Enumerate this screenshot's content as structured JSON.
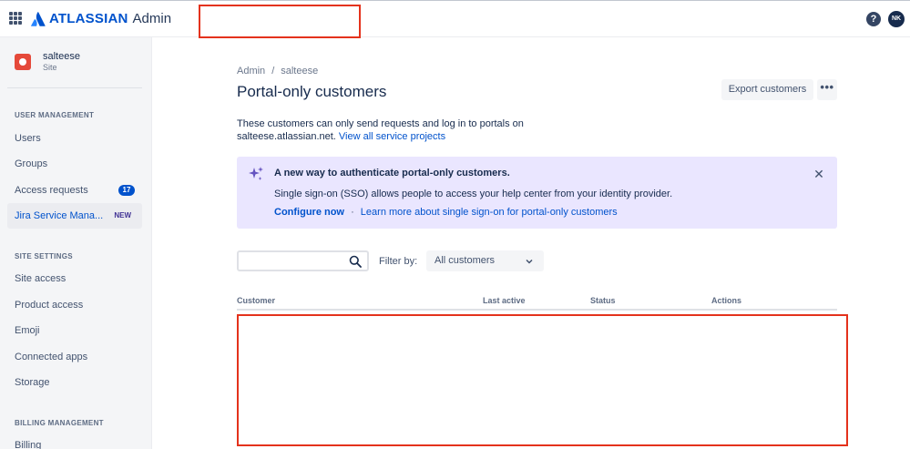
{
  "header": {
    "logo_word": "ATLASSIAN",
    "logo_product": "Admin",
    "help_icon": "question-circle-icon",
    "avatar_initials": "NK"
  },
  "sidebar": {
    "site_name": "salteese",
    "site_type": "Site",
    "sections": [
      {
        "heading": "USER MANAGEMENT"
      },
      {
        "heading": "SITE SETTINGS"
      },
      {
        "heading": "BILLING MANAGEMENT"
      }
    ],
    "items": {
      "users": "Users",
      "groups": "Groups",
      "access_requests": "Access requests",
      "access_requests_count": "17",
      "jira_service": "Jira Service Mana...",
      "jira_service_badge": "NEW",
      "site_access": "Site access",
      "product_access": "Product access",
      "emoji": "Emoji",
      "connected_apps": "Connected apps",
      "storage": "Storage",
      "billing": "Billing"
    }
  },
  "main": {
    "breadcrumb": [
      "Admin",
      "salteese"
    ],
    "breadcrumb_sep": "/",
    "title": "Portal-only customers",
    "export_label": "Export customers",
    "more_label": "•••",
    "description_text": "These customers can only send requests and log in to portals on salteese.atlassian.net.",
    "description_link": "View all service projects",
    "banner": {
      "title": "A new way to authenticate portal-only customers.",
      "body": "Single sign-on (SSO) allows people to access your help center from your identity provider.",
      "configure_link": "Configure now",
      "dot": "·",
      "learn_link": "Learn more about single sign-on for portal-only customers",
      "close_glyph": "✕"
    },
    "search": {
      "value": "",
      "placeholder": ""
    },
    "filter_label": "Filter by:",
    "filter_value": "All customers",
    "table_headers": [
      "Customer",
      "Last active",
      "Status",
      "Actions"
    ]
  },
  "colors": {
    "brand": "#0052cc",
    "banner_bg": "#eae6ff",
    "annotation_red": "#e4321c"
  }
}
